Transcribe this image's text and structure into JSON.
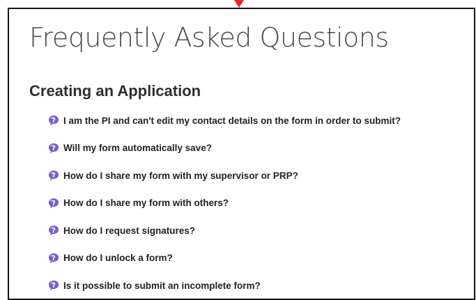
{
  "page": {
    "title": "Frequently Asked Questions"
  },
  "section": {
    "heading": "Creating an Application"
  },
  "colors": {
    "icon_dark": "#7a5cc9",
    "icon_light": "#a793e6",
    "pointer": "#e8261c"
  },
  "faq": {
    "icon_name": "question-bubble-icon",
    "items": [
      {
        "label": "I am the PI and can't edit my contact details on the form in order to submit?"
      },
      {
        "label": "Will my form automatically save?"
      },
      {
        "label": "How do I share my form with my supervisor or PRP?"
      },
      {
        "label": "How do I share my form with others?"
      },
      {
        "label": "How do I request signatures?"
      },
      {
        "label": "How do I unlock a form?"
      },
      {
        "label": "Is it possible to submit an incomplete form?"
      }
    ]
  }
}
